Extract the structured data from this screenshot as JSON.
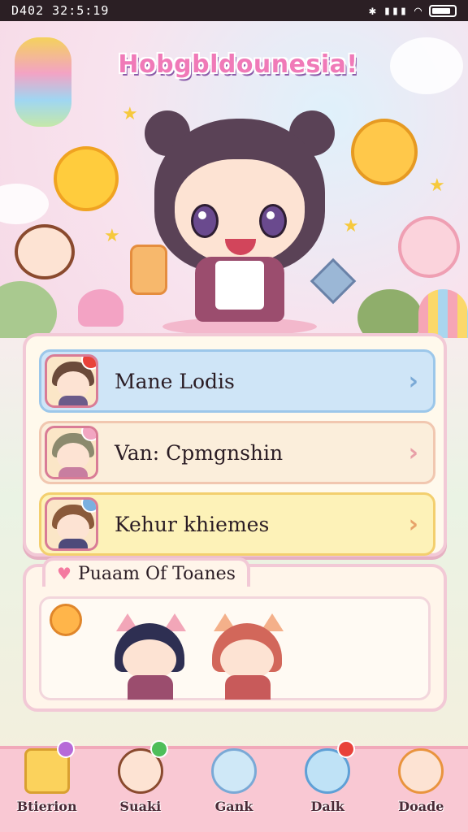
{
  "status_bar": {
    "time": "D402 32:5:19",
    "icons": [
      "bluetooth-icon",
      "signal-icon",
      "wifi-icon",
      "battery-icon"
    ]
  },
  "header": {
    "app_title": "Hobgbldounesia!"
  },
  "menu": {
    "items": [
      {
        "label": "Mane Lodis",
        "icon": "avatar-boy-icon",
        "bg": "#cfe5f7",
        "border": "#9cc7ea",
        "chev_color": "#7aa9d6"
      },
      {
        "label": "Van: Cpmgnshin",
        "icon": "avatar-kid-icon",
        "bg": "#fbeedb",
        "border": "#f1c7b0",
        "chev_color": "#e8a0a8"
      },
      {
        "label": "Kehur khiemes",
        "icon": "avatar-cat-icon",
        "bg": "#fdf2b8",
        "border": "#f3cf6e",
        "chev_color": "#e7a36a"
      }
    ]
  },
  "team": {
    "title": "Puaam Of Toanes",
    "members": [
      "cat-boy-navy",
      "cat-girl-red"
    ]
  },
  "bottom_nav": {
    "items": [
      {
        "label": "Btierion",
        "icon": "cheese-icon"
      },
      {
        "label": "Suaki",
        "icon": "avatar-boy-icon"
      },
      {
        "label": "Gank",
        "icon": "ghost-icon"
      },
      {
        "label": "Dalk",
        "icon": "avatar-blue-icon"
      },
      {
        "label": "Doade",
        "icon": "avatar-girl-icon"
      }
    ]
  },
  "colors": {
    "accent": "#f07ab8",
    "nav_bg": "#f9c8d3",
    "panel_border": "#f2c9d6"
  }
}
